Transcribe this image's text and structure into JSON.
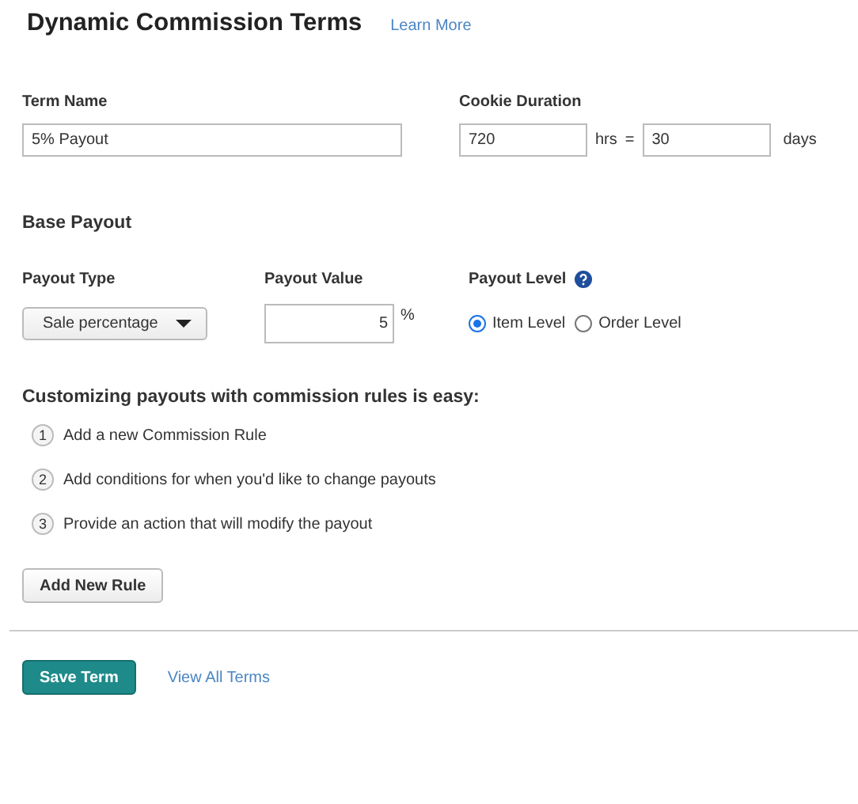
{
  "header": {
    "title": "Dynamic Commission Terms",
    "link": "Learn More"
  },
  "term_name": {
    "label": "Term Name",
    "value": "5% Payout"
  },
  "cookie_duration": {
    "label": "Cookie Duration",
    "hours": "720",
    "hours_unit": "hrs",
    "equals": "=",
    "days": "30",
    "days_unit": "days"
  },
  "base_payout": {
    "title": "Base Payout",
    "payout_type": {
      "label": "Payout Type",
      "value": "Sale percentage"
    },
    "payout_value": {
      "label": "Payout Value",
      "value": "5",
      "unit": "%"
    },
    "payout_level": {
      "label": "Payout Level",
      "options": [
        {
          "label": "Item Level",
          "selected": true
        },
        {
          "label": "Order Level",
          "selected": false
        }
      ]
    }
  },
  "rules": {
    "title": "Customizing payouts with commission rules is easy:",
    "steps": [
      {
        "number": "1",
        "text": "Add a new Commission Rule"
      },
      {
        "number": "2",
        "text": "Add conditions for when you'd like to change payouts"
      },
      {
        "number": "3",
        "text": "Provide an action that will modify the payout"
      }
    ],
    "button": "Add New Rule"
  },
  "footer": {
    "save": "Save Term",
    "view_all": "View All Terms"
  }
}
